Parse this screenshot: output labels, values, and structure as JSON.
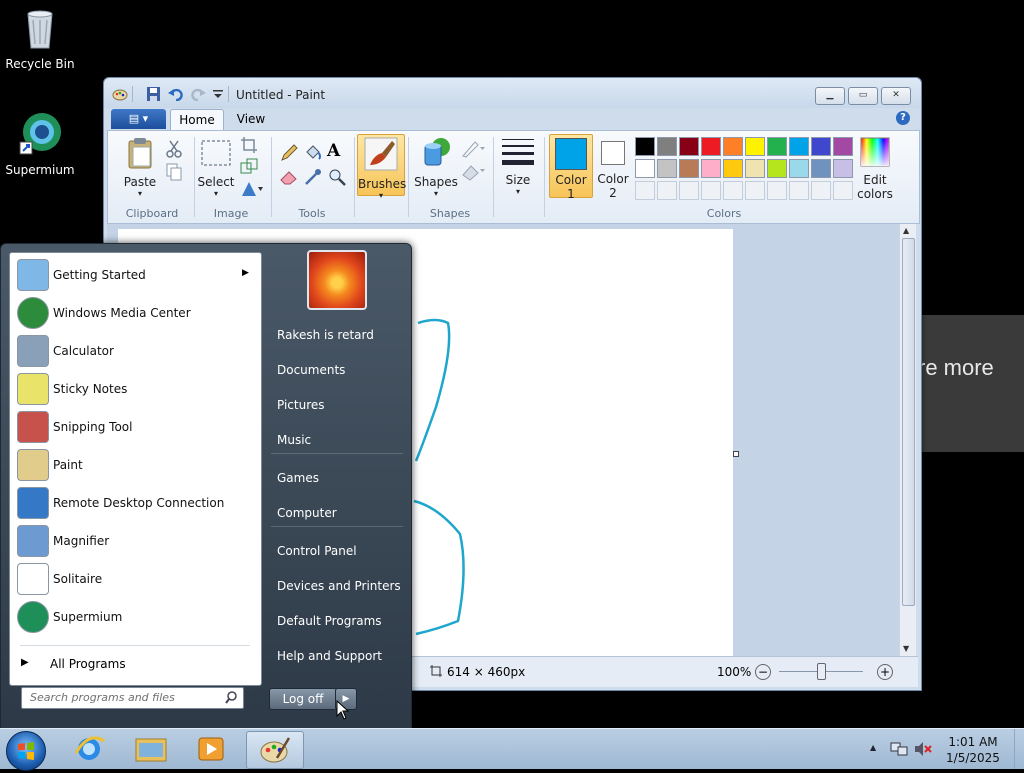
{
  "desktop": {
    "icons": [
      {
        "label": "Recycle Bin"
      },
      {
        "label": "Supermium"
      }
    ],
    "banner_text": "re more"
  },
  "paint": {
    "title": "Untitled - Paint",
    "tabs": {
      "home": "Home",
      "view": "View"
    },
    "groups": {
      "clipboard": "Clipboard",
      "image": "Image",
      "tools": "Tools",
      "shapes": "Shapes",
      "colors": "Colors"
    },
    "buttons": {
      "paste": "Paste",
      "select": "Select",
      "brushes": "Brushes",
      "shapes": "Shapes",
      "size": "Size",
      "color1_line1": "Color",
      "color1_line2": "1",
      "color2_line1": "Color",
      "color2_line2": "2",
      "edit_colors_line1": "Edit",
      "edit_colors_line2": "colors"
    },
    "palette_row1": [
      "#000000",
      "#7f7f7f",
      "#880015",
      "#ed1c24",
      "#ff7f27",
      "#fff200",
      "#22b14c",
      "#00a2e8",
      "#3f48cc",
      "#a349a4"
    ],
    "palette_row2": [
      "#ffffff",
      "#c3c3c3",
      "#b97a57",
      "#ffaec9",
      "#ffc90e",
      "#efe4b0",
      "#b5e61d",
      "#99d9ea",
      "#7092be",
      "#c8bfe7"
    ],
    "color1": "#00a2e8",
    "color2": "#ffffff",
    "status": {
      "canvas_size": "614 × 460px",
      "zoom": "100%"
    }
  },
  "start_menu": {
    "programs": [
      {
        "label": "Getting Started",
        "icon": "getting-started-icon"
      },
      {
        "label": "Windows Media Center",
        "icon": "media-center-icon"
      },
      {
        "label": "Calculator",
        "icon": "calculator-icon"
      },
      {
        "label": "Sticky Notes",
        "icon": "sticky-notes-icon"
      },
      {
        "label": "Snipping Tool",
        "icon": "snipping-tool-icon"
      },
      {
        "label": "Paint",
        "icon": "paint-icon"
      },
      {
        "label": "Remote Desktop Connection",
        "icon": "remote-desktop-icon"
      },
      {
        "label": "Magnifier",
        "icon": "magnifier-icon"
      },
      {
        "label": "Solitaire",
        "icon": "solitaire-icon"
      },
      {
        "label": "Supermium",
        "icon": "supermium-icon"
      }
    ],
    "all_programs": "All Programs",
    "search_placeholder": "Search programs and files",
    "right": [
      "Rakesh is retard",
      "Documents",
      "Pictures",
      "Music",
      "Games",
      "Computer",
      "Control Panel",
      "Devices and Printers",
      "Default Programs",
      "Help and Support"
    ],
    "logoff": "Log off"
  },
  "taskbar": {
    "time": "1:01 AM",
    "date": "1/5/2025"
  }
}
